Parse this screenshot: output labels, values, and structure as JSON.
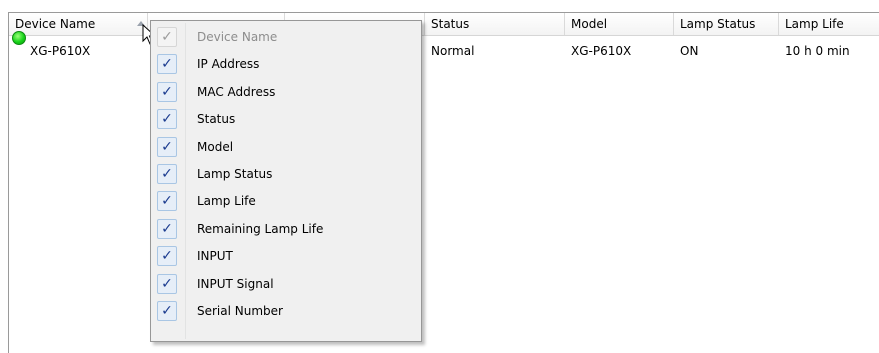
{
  "columns": [
    {
      "label": "Device Name"
    },
    {
      "label": ""
    },
    {
      "label": ""
    },
    {
      "label": "Status"
    },
    {
      "label": "Model"
    },
    {
      "label": "Lamp Status"
    },
    {
      "label": "Lamp Life"
    }
  ],
  "rows": [
    {
      "device_name": "XG-P610X",
      "status": "Normal",
      "model": "XG-P610X",
      "lamp_status": "ON",
      "lamp_life": "10 h 0 min",
      "status_color": "#17d31a"
    }
  ],
  "menu": {
    "items": [
      {
        "label": "Device Name",
        "checked": true,
        "enabled": false
      },
      {
        "label": "IP Address",
        "checked": true,
        "enabled": true
      },
      {
        "label": "MAC Address",
        "checked": true,
        "enabled": true
      },
      {
        "label": "Status",
        "checked": true,
        "enabled": true
      },
      {
        "label": "Model",
        "checked": true,
        "enabled": true
      },
      {
        "label": "Lamp Status",
        "checked": true,
        "enabled": true
      },
      {
        "label": "Lamp Life",
        "checked": true,
        "enabled": true
      },
      {
        "label": "Remaining Lamp Life",
        "checked": true,
        "enabled": true
      },
      {
        "label": "INPUT",
        "checked": true,
        "enabled": true
      },
      {
        "label": "INPUT Signal",
        "checked": true,
        "enabled": true
      },
      {
        "label": "Serial Number",
        "checked": true,
        "enabled": true
      }
    ],
    "check_glyph": "✓"
  }
}
